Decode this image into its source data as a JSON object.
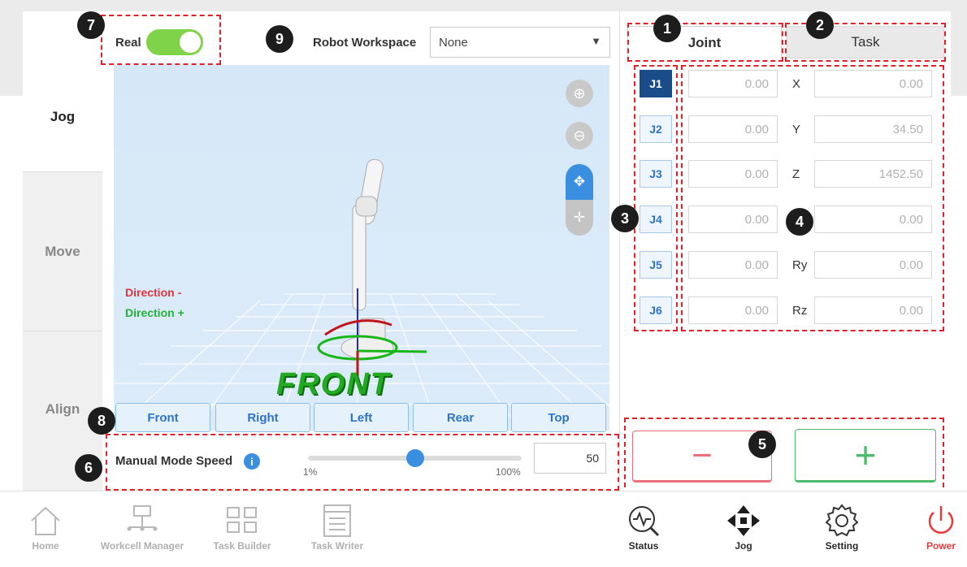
{
  "mode": {
    "label": "Real",
    "on": true
  },
  "workspace": {
    "label": "Robot Workspace",
    "value": "None"
  },
  "left_nav": [
    {
      "label": "Jog",
      "active": true
    },
    {
      "label": "Move",
      "active": false
    },
    {
      "label": "Align",
      "active": false
    }
  ],
  "viewport": {
    "direction_minus": "Direction -",
    "direction_plus": "Direction +",
    "front_text": "FRONT",
    "tools": [
      "zoom-in-icon",
      "zoom-out-icon",
      "rotate-icon",
      "pan-icon"
    ]
  },
  "view_buttons": [
    "Front",
    "Right",
    "Left",
    "Rear",
    "Top"
  ],
  "speed": {
    "label": "Manual Mode Speed",
    "min_label": "1%",
    "max_label": "100%",
    "value": "50",
    "slider_fraction": 0.5
  },
  "tabs": {
    "joint": "Joint",
    "task": "Task",
    "active": "joint"
  },
  "joints": [
    {
      "label": "J1",
      "value": "0.00",
      "selected": true
    },
    {
      "label": "J2",
      "value": "0.00",
      "selected": false
    },
    {
      "label": "J3",
      "value": "0.00",
      "selected": false
    },
    {
      "label": "J4",
      "value": "0.00",
      "selected": false
    },
    {
      "label": "J5",
      "value": "0.00",
      "selected": false
    },
    {
      "label": "J6",
      "value": "0.00",
      "selected": false
    }
  ],
  "task_values": [
    {
      "label": "X",
      "value": "0.00"
    },
    {
      "label": "Y",
      "value": "34.50"
    },
    {
      "label": "Z",
      "value": "1452.50"
    },
    {
      "label": "",
      "value": "0.00"
    },
    {
      "label": "Ry",
      "value": "0.00"
    },
    {
      "label": "Rz",
      "value": "0.00"
    }
  ],
  "jog_buttons": {
    "minus": "−",
    "plus": "+"
  },
  "bottom_nav": [
    {
      "label": "Home",
      "icon": "home-icon"
    },
    {
      "label": "Workcell Manager",
      "icon": "workcell-icon"
    },
    {
      "label": "Task Builder",
      "icon": "task-builder-icon"
    },
    {
      "label": "Task Writer",
      "icon": "task-writer-icon"
    },
    {
      "label": "Status",
      "icon": "status-icon"
    },
    {
      "label": "Jog",
      "icon": "jog-icon"
    },
    {
      "label": "Setting",
      "icon": "gear-icon"
    },
    {
      "label": "Power",
      "icon": "power-icon"
    }
  ],
  "badges": [
    "1",
    "2",
    "3",
    "4",
    "5",
    "6",
    "7",
    "8",
    "9"
  ],
  "colors": {
    "accent_blue": "#2d74c6",
    "selected_joint": "#1a4c8a",
    "toggle_green": "#7ed348",
    "annotation_red": "#e0202a",
    "minus_red": "#e9707a",
    "plus_green": "#4cbb6b",
    "power_red": "#e53a3a"
  }
}
